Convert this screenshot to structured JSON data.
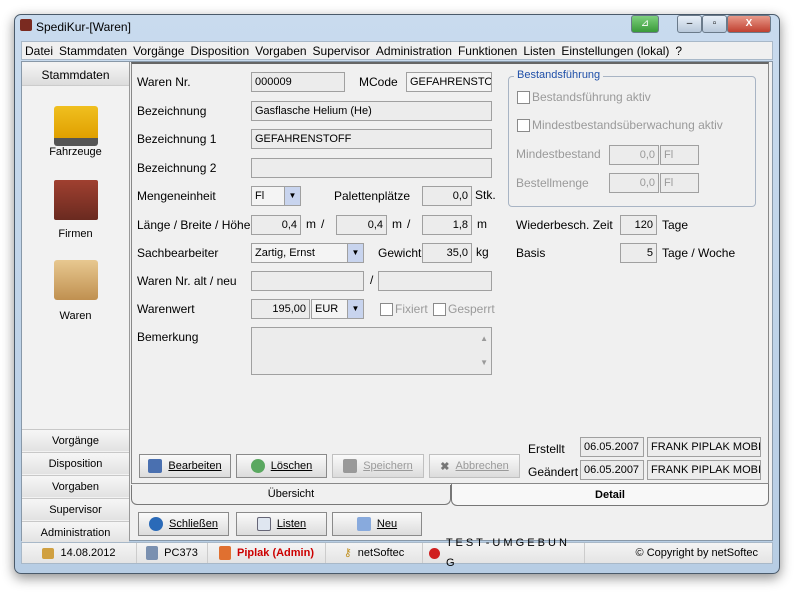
{
  "window": {
    "title": "SpediKur-[Waren]"
  },
  "menu": [
    "Datei",
    "Stammdaten",
    "Vorgänge",
    "Disposition",
    "Vorgaben",
    "Supervisor",
    "Administration",
    "Funktionen",
    "Listen",
    "Einstellungen (lokal)",
    "?"
  ],
  "sidebar": {
    "header": "Stammdaten",
    "items": [
      {
        "label": "Fahrzeuge",
        "icon": "truck-icon"
      },
      {
        "label": "Firmen",
        "icon": "factory-icon"
      },
      {
        "label": "Waren",
        "icon": "box-icon"
      }
    ],
    "sections": [
      "Vorgänge",
      "Disposition",
      "Vorgaben",
      "Supervisor",
      "Administration"
    ]
  },
  "form": {
    "waren_nr": {
      "label": "Waren Nr.",
      "value": "000009"
    },
    "mcode": {
      "label": "MCode",
      "value": "GEFAHRENSTOFF"
    },
    "bezeichnung": {
      "label": "Bezeichnung",
      "value": "Gasflasche Helium (He)"
    },
    "bezeichnung1": {
      "label": "Bezeichnung 1",
      "value": "GEFAHRENSTOFF"
    },
    "bezeichnung2": {
      "label": "Bezeichnung 2",
      "value": ""
    },
    "mengeneinheit": {
      "label": "Mengeneinheit",
      "value": "Fl"
    },
    "palettenplaetze": {
      "label": "Palettenplätze",
      "value": "0,0",
      "unit": "Stk."
    },
    "lbh": {
      "label": "Länge / Breite / Höhe",
      "laenge": "0,4",
      "breite": "0,4",
      "hoehe": "1,8",
      "unit": "m",
      "sep": "/"
    },
    "sachbearbeiter": {
      "label": "Sachbearbeiter",
      "value": "Zartig, Ernst"
    },
    "gewicht": {
      "label": "Gewicht",
      "value": "35,0",
      "unit": "kg"
    },
    "waren_nr_alt_neu": {
      "label": "Waren Nr. alt / neu",
      "alt": "",
      "neu": "",
      "sep": "/"
    },
    "warenwert": {
      "label": "Warenwert",
      "value": "195,00",
      "currency": "EUR"
    },
    "fixiert": {
      "label": "Fixiert",
      "checked": false
    },
    "gesperrt": {
      "label": "Gesperrt",
      "checked": false
    },
    "bemerkung": {
      "label": "Bemerkung",
      "value": ""
    }
  },
  "bestand": {
    "title": "Bestandsführung",
    "aktiv": {
      "label": "Bestandsführung aktiv",
      "checked": false
    },
    "mindest_aktiv": {
      "label": "Mindestbestandsüberwachung aktiv",
      "checked": false
    },
    "mindestbestand": {
      "label": "Mindestbestand",
      "value": "0,0",
      "unit": "Fl"
    },
    "bestellmenge": {
      "label": "Bestellmenge",
      "value": "0,0",
      "unit": "Fl"
    }
  },
  "wiederbesch": {
    "label": "Wiederbesch. Zeit",
    "value": "120",
    "unit": "Tage"
  },
  "basis": {
    "label": "Basis",
    "value": "5",
    "unit": "Tage / Woche"
  },
  "erstellt": {
    "label": "Erstellt",
    "date": "06.05.2007",
    "user": "FRANK PIPLAK MOBIL"
  },
  "geaendert": {
    "label": "Geändert",
    "date": "06.05.2007",
    "user": "FRANK PIPLAK MOBIL"
  },
  "actions": {
    "bearbeiten": "Bearbeiten",
    "loeschen": "Löschen",
    "speichern": "Speichern",
    "abbrechen": "Abbrechen"
  },
  "tabs": [
    {
      "label": "Übersicht",
      "active": false
    },
    {
      "label": "Detail",
      "active": true
    }
  ],
  "bottom": {
    "schliessen": "Schließen",
    "listen": "Listen",
    "neu": "Neu"
  },
  "status": {
    "date": "14.08.2012",
    "pc": "PC373",
    "user": "Piplak (Admin)",
    "company": "netSoftec",
    "env": "T E S T - U M G E B U N G",
    "copyright": "© Copyright by netSoftec"
  },
  "colors": {
    "user": "#cc0000",
    "group_title": "#1f4fa8",
    "dropdown": "#c8d4ee"
  }
}
